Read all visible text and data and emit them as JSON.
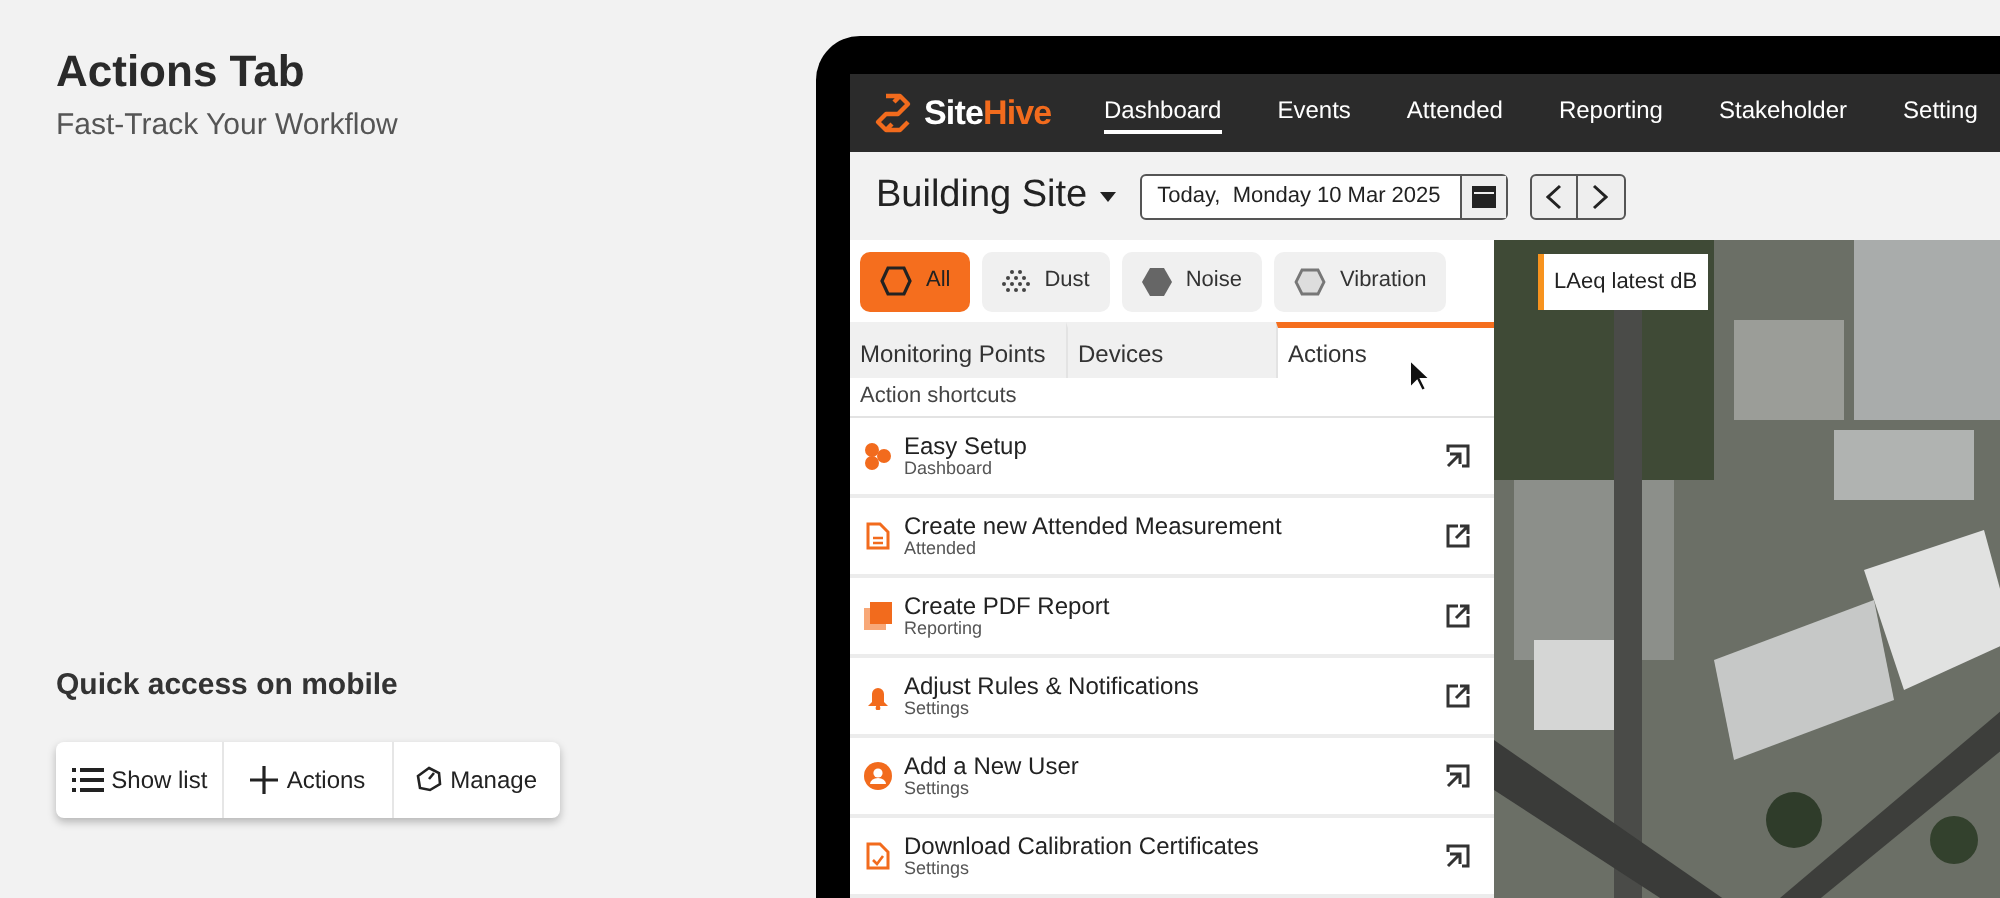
{
  "intro": {
    "title": "Actions Tab",
    "subtitle": "Fast-Track Your Workflow"
  },
  "mobile": {
    "heading": "Quick access on mobile",
    "buttons": [
      {
        "kind": "list",
        "label": "Show list"
      },
      {
        "kind": "plus",
        "label": "Actions"
      },
      {
        "kind": "manage",
        "label": "Manage"
      }
    ]
  },
  "app": {
    "logo": [
      "Site",
      "Hive"
    ],
    "nav": [
      {
        "label": "Dashboard",
        "selected": true
      },
      {
        "label": "Events",
        "selected": false
      },
      {
        "label": "Attended",
        "selected": false
      },
      {
        "label": "Reporting",
        "selected": false
      },
      {
        "label": "Stakeholder",
        "selected": false
      },
      {
        "label": "Setting",
        "selected": false
      }
    ],
    "site": "Building Site",
    "date": "Today,  Monday 10 Mar 2025",
    "filters": [
      {
        "kind": "all",
        "label": "All",
        "selected": true
      },
      {
        "kind": "dust",
        "label": "Dust",
        "selected": false
      },
      {
        "kind": "noise",
        "label": "Noise",
        "selected": false
      },
      {
        "kind": "vibration",
        "label": "Vibration",
        "selected": false
      }
    ],
    "tabs": [
      {
        "label": "Monitoring Points",
        "selected": false
      },
      {
        "label": "Devices",
        "selected": false
      },
      {
        "label": "Actions",
        "selected": true
      }
    ],
    "section": "Action shortcuts",
    "actions": [
      {
        "kind": "setup",
        "title": "Easy Setup",
        "subtitle": "Dashboard",
        "external": false
      },
      {
        "kind": "document",
        "title": "Create new Attended Measurement",
        "subtitle": "Attended",
        "external": true
      },
      {
        "kind": "pdf",
        "title": "Create PDF Report",
        "subtitle": "Reporting",
        "external": true
      },
      {
        "kind": "bell",
        "title": "Adjust Rules & Notifications",
        "subtitle": "Settings",
        "external": true
      },
      {
        "kind": "user",
        "title": "Add a New User",
        "subtitle": "Settings",
        "external": false
      },
      {
        "kind": "certificate",
        "title": "Download Calibration Certificates",
        "subtitle": "Settings",
        "external": false
      }
    ],
    "map_label": "LAeq latest dB"
  }
}
